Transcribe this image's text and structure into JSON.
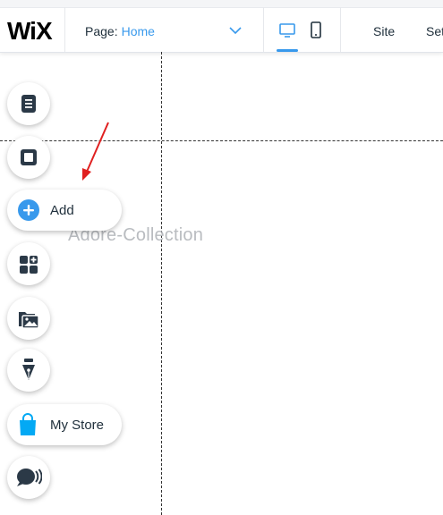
{
  "header": {
    "logo": "WiX",
    "page_label": "Page:",
    "page_value": "Home",
    "menu": [
      "Site",
      "Set"
    ]
  },
  "canvas": {
    "watermark": "Adore-Collection"
  },
  "left_panel": {
    "add_label": "Add",
    "store_label": "My Store"
  },
  "colors": {
    "accent": "#3899ec",
    "icon_dark": "#2b3947",
    "store_blue": "#03a9f4",
    "arrow_red": "#e02020"
  }
}
